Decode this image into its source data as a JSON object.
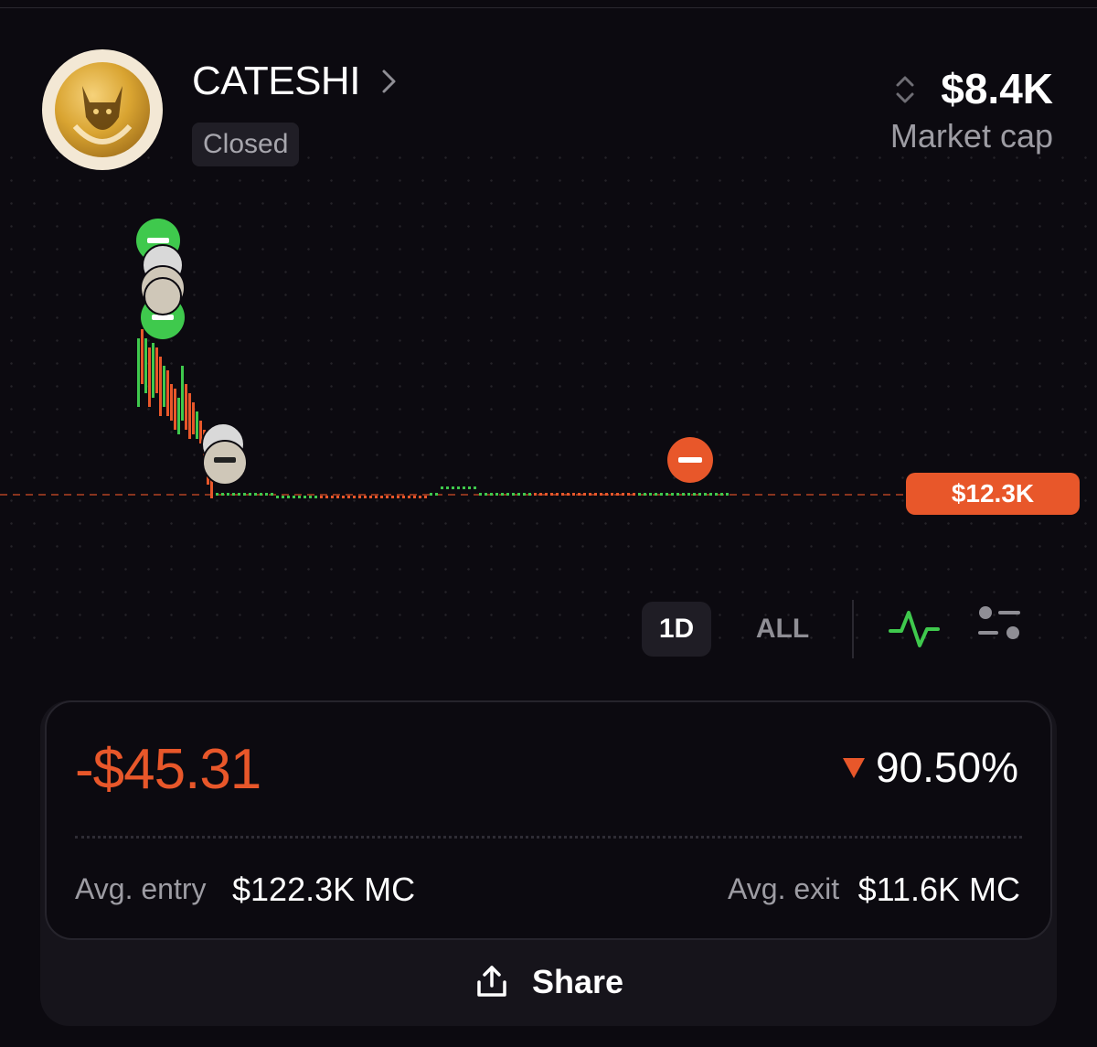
{
  "token": {
    "name": "CATESHI",
    "status": "Closed",
    "market_cap_value": "$8.4K",
    "market_cap_label": "Market cap",
    "logo_icon": "cat-hood-logo-icon"
  },
  "chart": {
    "current_price_label": "$12.3K",
    "timeframes": [
      "1D",
      "ALL"
    ],
    "selected_timeframe": "1D",
    "chart_style_icon": "line-chart-icon",
    "settings_icon": "sliders-icon",
    "colors": {
      "up": "#3fc94d",
      "down": "#e8572a",
      "price_line": "#e8572a"
    },
    "markers": [
      {
        "type": "buy",
        "icon": "buy-marker-icon"
      },
      {
        "type": "buy",
        "icon": "buy-marker-icon"
      },
      {
        "type": "sell",
        "icon": "sell-marker-icon"
      }
    ]
  },
  "position": {
    "pnl": "-$45.31",
    "percent": "90.50%",
    "direction_icon": "down-triangle-icon",
    "avg_entry_label": "Avg. entry",
    "avg_entry_value": "$122.3K MC",
    "avg_exit_label": "Avg. exit",
    "avg_exit_value": "$11.6K MC",
    "pnl_color": "#e8572a"
  },
  "actions": {
    "share_label": "Share",
    "share_icon": "share-icon"
  }
}
